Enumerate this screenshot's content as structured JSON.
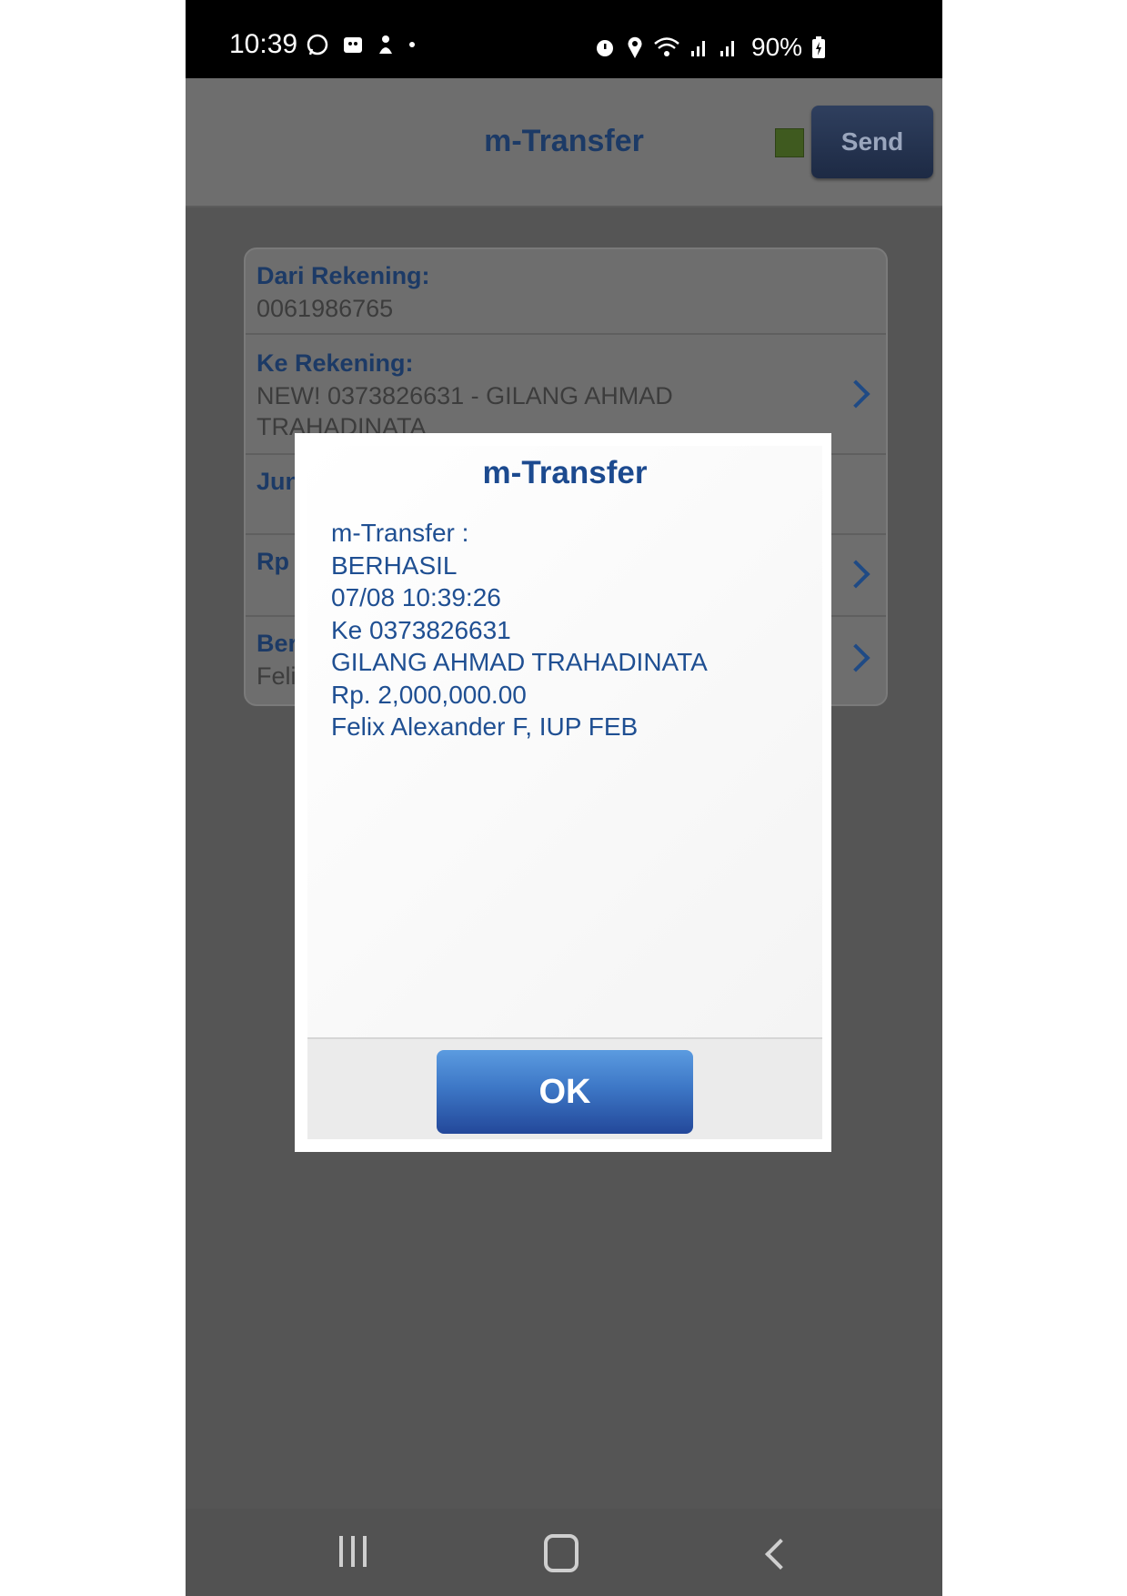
{
  "status_bar": {
    "time": "10:39",
    "battery": "90%",
    "left_icons": [
      "whatsapp-icon",
      "gallery-icon",
      "app-icon",
      "dot-icon"
    ],
    "right_icons": [
      "alarm-icon",
      "location-icon",
      "wifi-icon",
      "signal-icon",
      "signal-icon",
      "battery-icon"
    ]
  },
  "header": {
    "title": "m-Transfer",
    "send_label": "Send",
    "status_color": "#3f5a1f"
  },
  "form": {
    "from_label": "Dari Rekening:",
    "from_value": "0061986765",
    "to_label": "Ke Rekening:",
    "to_value": "NEW! 0373826631 - GILANG AHMAD TRAHADINATA",
    "jumlah_label": "Jun",
    "rp_label": "Rp",
    "berita_label": "Ber",
    "berita_value": "Feli"
  },
  "dialog": {
    "title": "m-Transfer",
    "lines": [
      "m-Transfer :",
      "BERHASIL",
      "07/08 10:39:26",
      "Ke 0373826631",
      "GILANG AHMAD TRAHADINATA",
      "Rp. 2,000,000.00",
      "Felix Alexander F, IUP FEB"
    ],
    "ok_label": "OK"
  },
  "nav": {
    "icons": [
      "recents-icon",
      "home-icon",
      "back-icon"
    ]
  }
}
